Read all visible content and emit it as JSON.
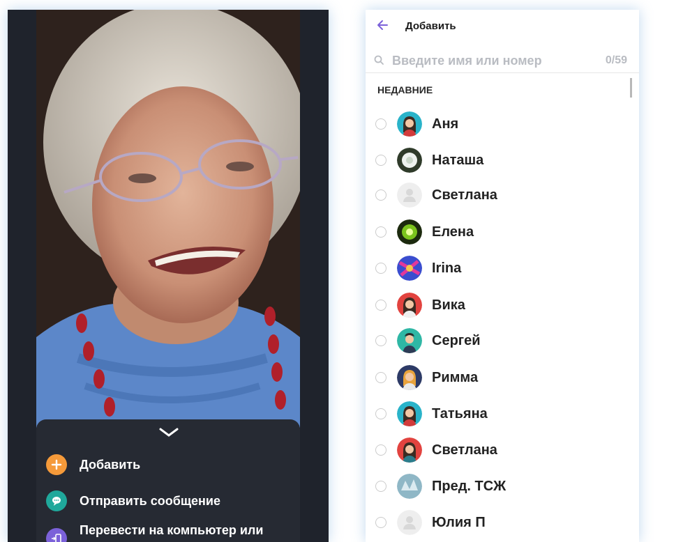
{
  "left_screen": {
    "actions": [
      {
        "label": "Добавить",
        "icon": "add-icon",
        "color": "#f59a3a"
      },
      {
        "label": "Отправить сообщение",
        "icon": "message-icon",
        "color": "#1fa89b"
      },
      {
        "label": "Перевести на компьютер или планшет",
        "icon": "transfer-device-icon",
        "color": "#7b61d9"
      }
    ]
  },
  "right_screen": {
    "title": "Добавить",
    "search": {
      "placeholder": "Введите имя или номер",
      "value": ""
    },
    "counter": "0/59",
    "section_header": "НЕДАВНИЕ",
    "contacts": [
      {
        "name": "Аня",
        "avatar": "woman-teal-avatar"
      },
      {
        "name": "Наташа",
        "avatar": "flower-photo-avatar"
      },
      {
        "name": "Светлана",
        "avatar": "default-avatar"
      },
      {
        "name": "Елена",
        "avatar": "green-burst-photo-avatar"
      },
      {
        "name": "Irina",
        "avatar": "colorful-photo-avatar"
      },
      {
        "name": "Вика",
        "avatar": "woman-red-avatar"
      },
      {
        "name": "Сергей",
        "avatar": "man-teal-avatar"
      },
      {
        "name": "Римма",
        "avatar": "woman-navy-avatar"
      },
      {
        "name": "Татьяна",
        "avatar": "woman-teal-avatar"
      },
      {
        "name": "Светлана",
        "avatar": "woman-red-avatar"
      },
      {
        "name": "Пред. ТСЖ",
        "avatar": "ice-photo-avatar"
      },
      {
        "name": "Юлия П",
        "avatar": "default-avatar"
      }
    ]
  },
  "colors": {
    "accent": "#7b61d9",
    "dark_bg": "#1f232c",
    "sheet_bg": "#262a33"
  }
}
